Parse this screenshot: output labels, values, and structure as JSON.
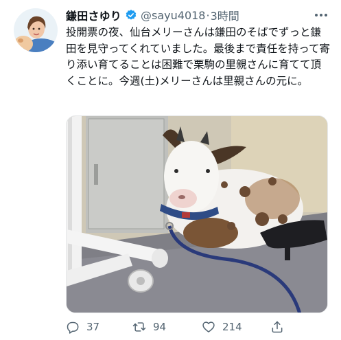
{
  "tweet": {
    "display_name": "鎌田さゆり",
    "handle": "@sayu4018",
    "separator": "·",
    "timestamp": "3時間",
    "text": "投開票の夜、仙台メリーさんは鎌田のそばでずっと鎌田を見守ってくれていました。最後まで責任を持って寄り添い育てることは困難で栗駒の里親さんに育てて頂くことに。今週(土)メリーさんは里親さんの元に。",
    "verified": true,
    "media_description": "photo",
    "counts": {
      "replies": "37",
      "retweets": "94",
      "likes": "214"
    }
  },
  "icons": {
    "verified": "verified-badge-icon",
    "more": "more-options-icon",
    "reply": "reply-icon",
    "retweet": "retweet-icon",
    "like": "like-icon",
    "share": "share-icon"
  },
  "colors": {
    "text": "#0f1419",
    "secondary": "#536471",
    "verified": "#1d9bf0"
  }
}
